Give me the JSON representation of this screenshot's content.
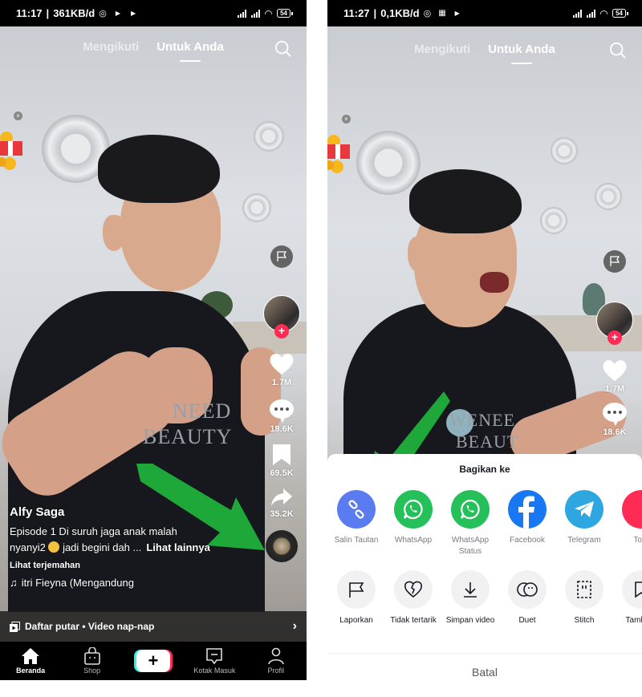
{
  "left_phone": {
    "statusbar": {
      "time": "11:17",
      "speed": "361KB/d",
      "battery": "54"
    },
    "tabs": [
      {
        "label": "Mengikuti",
        "active": false
      },
      {
        "label": "Untuk Anda",
        "active": true
      }
    ],
    "shirt_text": [
      "NEED",
      "BEAUTY"
    ],
    "actions": {
      "likes": "1.7M",
      "comments": "18.6K",
      "bookmarks": "69.5K",
      "shares": "35.2K"
    },
    "caption": {
      "author": "Alfy Saga",
      "desc_line1": "Episode 1  Di suruh jaga anak malah",
      "desc_line2_a": "nyanyi2",
      "desc_line2_b": "jadi begini dah ...",
      "see_more": "Lihat lainnya",
      "translate": "Lihat terjemahan",
      "music": "itri Fieyna (Mengandung"
    },
    "playlist": "Daftar putar • Video nap-nap",
    "nav": [
      {
        "label": "Beranda",
        "icon": "home-icon",
        "active": true
      },
      {
        "label": "Shop",
        "icon": "shop-bag-icon",
        "active": false
      },
      {
        "label": "",
        "icon": "create-plus-icon",
        "active": false
      },
      {
        "label": "Kotak Masuk",
        "icon": "inbox-icon",
        "active": false
      },
      {
        "label": "Profil",
        "icon": "profile-icon",
        "active": false
      }
    ]
  },
  "right_phone": {
    "statusbar": {
      "time": "11:27",
      "speed": "0,1KB/d",
      "battery": "54"
    },
    "tabs": [
      {
        "label": "Mengikuti",
        "active": false
      },
      {
        "label": "Untuk Anda",
        "active": true
      }
    ],
    "shirt_text": [
      "WENEE",
      "BEAUT"
    ],
    "actions": {
      "likes": "1.7M",
      "comments": "18.6K"
    },
    "share_sheet": {
      "title": "Bagikan ke",
      "row1": [
        {
          "label": "Salin Tautan",
          "icon": "link-icon",
          "color": "#5b7cf0"
        },
        {
          "label": "WhatsApp",
          "icon": "whatsapp-icon",
          "color": "#25c05a"
        },
        {
          "label": "WhatsApp Status",
          "icon": "whatsapp-icon",
          "color": "#25c05a"
        },
        {
          "label": "Facebook",
          "icon": "facebook-icon",
          "color": "#1877f2"
        },
        {
          "label": "Telegram",
          "icon": "telegram-icon",
          "color": "#2ea6e0"
        },
        {
          "label": "To T",
          "icon": "partial-icon",
          "color": "#fe2c55"
        }
      ],
      "row2": [
        {
          "label": "Laporkan",
          "icon": "flag-icon"
        },
        {
          "label": "Tidak tertarik",
          "icon": "broken-heart-icon"
        },
        {
          "label": "Simpan video",
          "icon": "download-icon"
        },
        {
          "label": "Duet",
          "icon": "duet-icon"
        },
        {
          "label": "Stitch",
          "icon": "stitch-icon"
        },
        {
          "label": "Tamb Fa",
          "icon": "bookmark-icon"
        }
      ],
      "cancel": "Batal"
    }
  },
  "annotation_color": "#1fa83a"
}
